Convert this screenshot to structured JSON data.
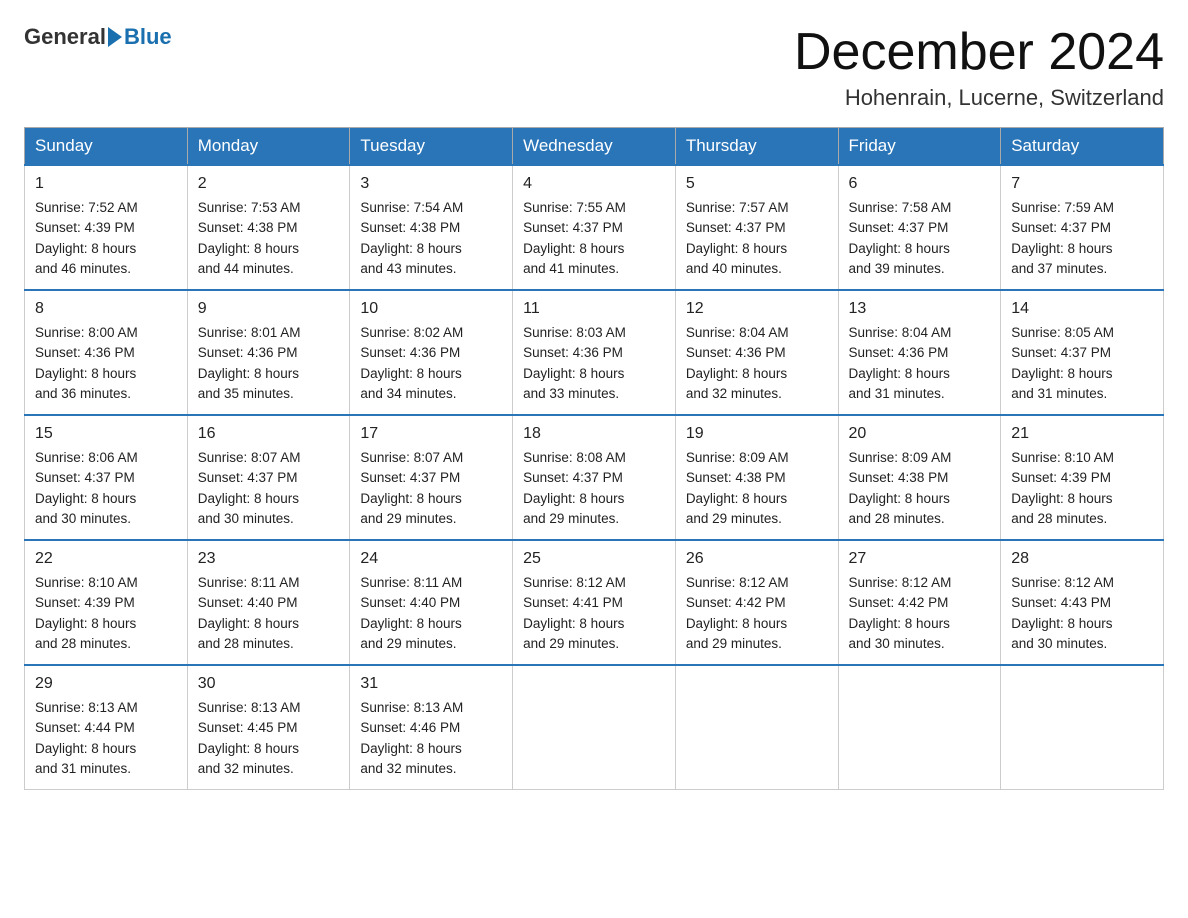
{
  "header": {
    "logo_general": "General",
    "logo_blue": "Blue",
    "month_title": "December 2024",
    "location": "Hohenrain, Lucerne, Switzerland"
  },
  "weekdays": [
    "Sunday",
    "Monday",
    "Tuesday",
    "Wednesday",
    "Thursday",
    "Friday",
    "Saturday"
  ],
  "weeks": [
    [
      {
        "day": "1",
        "sunrise": "7:52 AM",
        "sunset": "4:39 PM",
        "daylight": "8 hours and 46 minutes."
      },
      {
        "day": "2",
        "sunrise": "7:53 AM",
        "sunset": "4:38 PM",
        "daylight": "8 hours and 44 minutes."
      },
      {
        "day": "3",
        "sunrise": "7:54 AM",
        "sunset": "4:38 PM",
        "daylight": "8 hours and 43 minutes."
      },
      {
        "day": "4",
        "sunrise": "7:55 AM",
        "sunset": "4:37 PM",
        "daylight": "8 hours and 41 minutes."
      },
      {
        "day": "5",
        "sunrise": "7:57 AM",
        "sunset": "4:37 PM",
        "daylight": "8 hours and 40 minutes."
      },
      {
        "day": "6",
        "sunrise": "7:58 AM",
        "sunset": "4:37 PM",
        "daylight": "8 hours and 39 minutes."
      },
      {
        "day": "7",
        "sunrise": "7:59 AM",
        "sunset": "4:37 PM",
        "daylight": "8 hours and 37 minutes."
      }
    ],
    [
      {
        "day": "8",
        "sunrise": "8:00 AM",
        "sunset": "4:36 PM",
        "daylight": "8 hours and 36 minutes."
      },
      {
        "day": "9",
        "sunrise": "8:01 AM",
        "sunset": "4:36 PM",
        "daylight": "8 hours and 35 minutes."
      },
      {
        "day": "10",
        "sunrise": "8:02 AM",
        "sunset": "4:36 PM",
        "daylight": "8 hours and 34 minutes."
      },
      {
        "day": "11",
        "sunrise": "8:03 AM",
        "sunset": "4:36 PM",
        "daylight": "8 hours and 33 minutes."
      },
      {
        "day": "12",
        "sunrise": "8:04 AM",
        "sunset": "4:36 PM",
        "daylight": "8 hours and 32 minutes."
      },
      {
        "day": "13",
        "sunrise": "8:04 AM",
        "sunset": "4:36 PM",
        "daylight": "8 hours and 31 minutes."
      },
      {
        "day": "14",
        "sunrise": "8:05 AM",
        "sunset": "4:37 PM",
        "daylight": "8 hours and 31 minutes."
      }
    ],
    [
      {
        "day": "15",
        "sunrise": "8:06 AM",
        "sunset": "4:37 PM",
        "daylight": "8 hours and 30 minutes."
      },
      {
        "day": "16",
        "sunrise": "8:07 AM",
        "sunset": "4:37 PM",
        "daylight": "8 hours and 30 minutes."
      },
      {
        "day": "17",
        "sunrise": "8:07 AM",
        "sunset": "4:37 PM",
        "daylight": "8 hours and 29 minutes."
      },
      {
        "day": "18",
        "sunrise": "8:08 AM",
        "sunset": "4:37 PM",
        "daylight": "8 hours and 29 minutes."
      },
      {
        "day": "19",
        "sunrise": "8:09 AM",
        "sunset": "4:38 PM",
        "daylight": "8 hours and 29 minutes."
      },
      {
        "day": "20",
        "sunrise": "8:09 AM",
        "sunset": "4:38 PM",
        "daylight": "8 hours and 28 minutes."
      },
      {
        "day": "21",
        "sunrise": "8:10 AM",
        "sunset": "4:39 PM",
        "daylight": "8 hours and 28 minutes."
      }
    ],
    [
      {
        "day": "22",
        "sunrise": "8:10 AM",
        "sunset": "4:39 PM",
        "daylight": "8 hours and 28 minutes."
      },
      {
        "day": "23",
        "sunrise": "8:11 AM",
        "sunset": "4:40 PM",
        "daylight": "8 hours and 28 minutes."
      },
      {
        "day": "24",
        "sunrise": "8:11 AM",
        "sunset": "4:40 PM",
        "daylight": "8 hours and 29 minutes."
      },
      {
        "day": "25",
        "sunrise": "8:12 AM",
        "sunset": "4:41 PM",
        "daylight": "8 hours and 29 minutes."
      },
      {
        "day": "26",
        "sunrise": "8:12 AM",
        "sunset": "4:42 PM",
        "daylight": "8 hours and 29 minutes."
      },
      {
        "day": "27",
        "sunrise": "8:12 AM",
        "sunset": "4:42 PM",
        "daylight": "8 hours and 30 minutes."
      },
      {
        "day": "28",
        "sunrise": "8:12 AM",
        "sunset": "4:43 PM",
        "daylight": "8 hours and 30 minutes."
      }
    ],
    [
      {
        "day": "29",
        "sunrise": "8:13 AM",
        "sunset": "4:44 PM",
        "daylight": "8 hours and 31 minutes."
      },
      {
        "day": "30",
        "sunrise": "8:13 AM",
        "sunset": "4:45 PM",
        "daylight": "8 hours and 32 minutes."
      },
      {
        "day": "31",
        "sunrise": "8:13 AM",
        "sunset": "4:46 PM",
        "daylight": "8 hours and 32 minutes."
      },
      null,
      null,
      null,
      null
    ]
  ],
  "labels": {
    "sunrise": "Sunrise:",
    "sunset": "Sunset:",
    "daylight": "Daylight:"
  }
}
